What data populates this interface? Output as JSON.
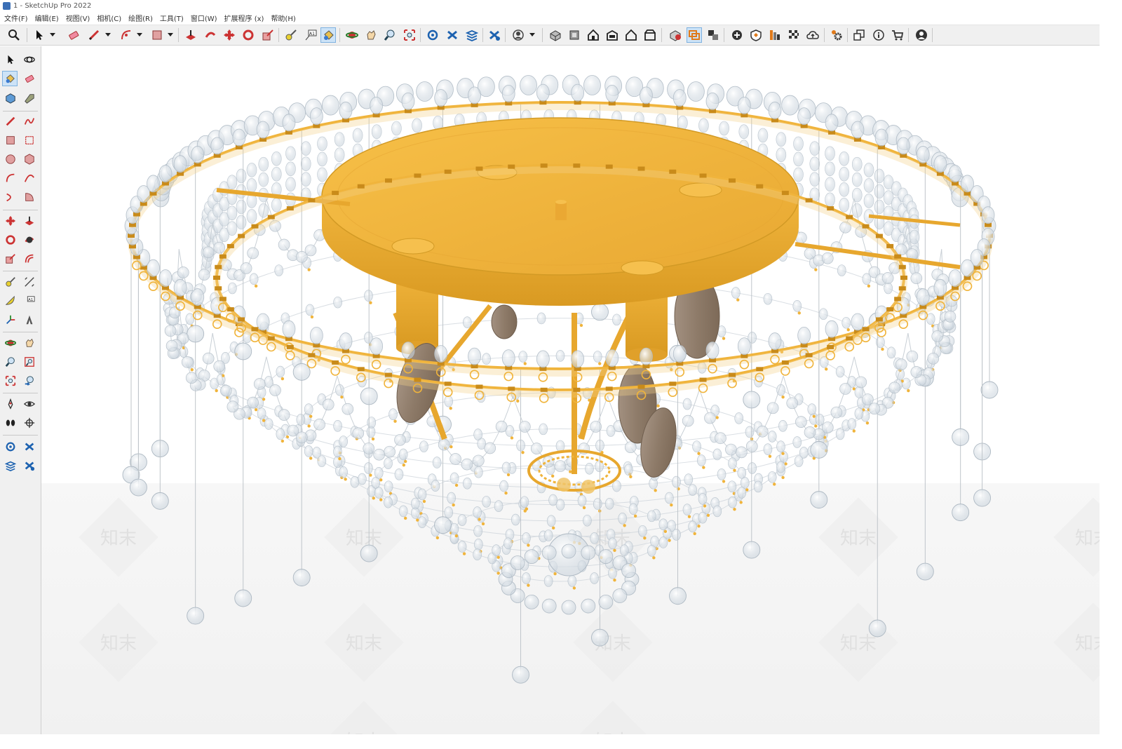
{
  "window": {
    "title": "1 - SketchUp Pro 2022"
  },
  "menu": {
    "items": [
      "文件(F)",
      "编辑(E)",
      "视图(V)",
      "相机(C)",
      "绘图(R)",
      "工具(T)",
      "窗口(W)",
      "扩展程序 (x)",
      "帮助(H)"
    ]
  },
  "toolbar": {
    "active_tool": "paint-bucket",
    "icons": [
      "search-icon",
      "select-icon",
      "eraser-icon",
      "pencil-icon",
      "arc-icon",
      "rectangle-icon",
      "push-pull-icon",
      "follow-me-icon",
      "move-icon",
      "rotate-icon",
      "scale-icon",
      "tape-measure-icon",
      "text-icon",
      "paint-bucket-icon",
      "orbit-icon",
      "pan-icon",
      "zoom-icon",
      "zoom-extents-icon",
      "warehouse-icon",
      "extension-warehouse-icon",
      "layout-icon",
      "extension-manager-icon",
      "account-icon",
      "iso-view-icon",
      "top-view-icon",
      "front-view-icon",
      "right-view-icon",
      "back-view-icon",
      "left-view-icon",
      "xray-icon",
      "section-plane-icon",
      "section-cut-icon",
      "add-location-icon",
      "shadow-icon",
      "styles-icon",
      "fog-icon",
      "cloud-icon",
      "settings-icon",
      "outliner-icon",
      "info-icon",
      "cart-icon",
      "user-icon"
    ]
  },
  "left_toolbar": {
    "icons": [
      "select-icon",
      "orbit-icon",
      "paint-bucket-icon",
      "eraser-icon",
      "component-icon",
      "tag-icon",
      "pencil-icon",
      "freehand-icon",
      "rectangle-icon",
      "rotated-rectangle-icon",
      "circle-icon",
      "polygon-icon",
      "arc-icon",
      "two-point-arc-icon",
      "three-point-arc-icon",
      "pie-icon",
      "move-icon",
      "push-pull-icon",
      "rotate-icon",
      "follow-me-icon",
      "scale-icon",
      "offset-icon",
      "tape-measure-icon",
      "dimension-icon",
      "protractor-icon",
      "text-icon",
      "axes-icon",
      "3d-text-icon",
      "orbit2-icon",
      "pan-icon",
      "zoom-icon",
      "zoom-window-icon",
      "zoom-extents-icon",
      "previous-view-icon",
      "position-camera-icon",
      "look-around-icon",
      "walk-icon",
      "section-plane-icon",
      "warehouse-icon",
      "extension-warehouse-icon",
      "layout-icon",
      "extension-manager-icon"
    ]
  },
  "viewport": {
    "watermark_text": "知末",
    "colors": {
      "gold": "#f0b43c",
      "gold_dark": "#c98b1a",
      "crystal": "#dfe6ec",
      "bulb": "#8e7b69",
      "ground": "#f4f4f4"
    }
  }
}
